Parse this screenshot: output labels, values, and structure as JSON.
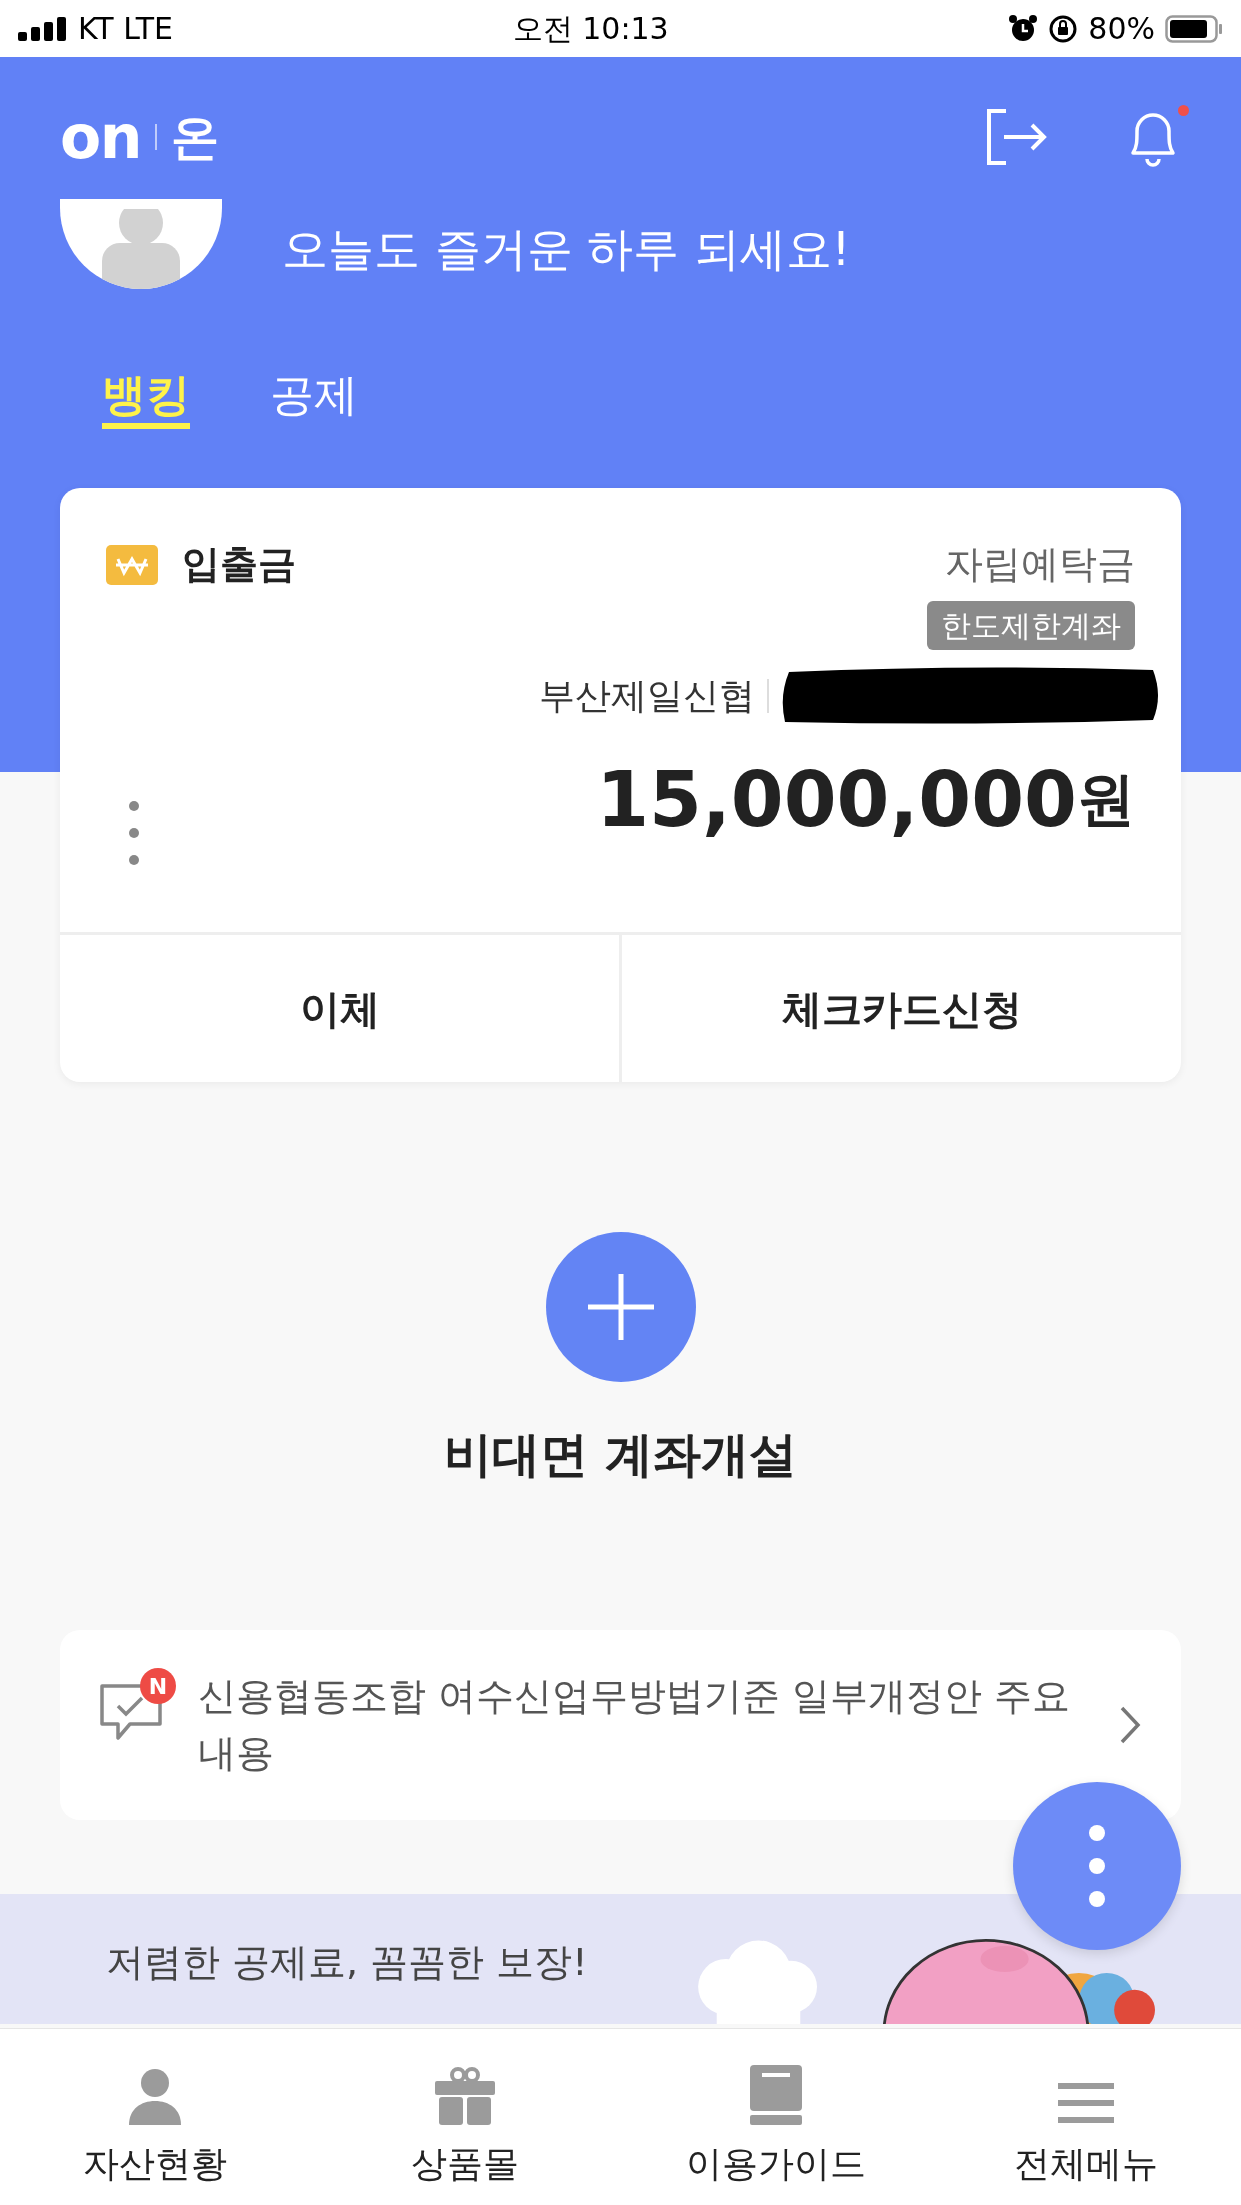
{
  "status_bar": {
    "carrier": "KT LTE",
    "time": "오전 10:13",
    "battery": "80%"
  },
  "header": {
    "logo": "on",
    "brand": "온",
    "notification_dot": true,
    "greeting": "오늘도 즐거운 하루 되세요!"
  },
  "tabs": [
    {
      "label": "뱅킹",
      "selected": true
    },
    {
      "label": "공제",
      "selected": false
    }
  ],
  "account_card": {
    "title": "입출금",
    "product": "자립예탁금",
    "badge": "한도제한계좌",
    "bank": "부산제일신협",
    "account_number_redacted": true,
    "balance": "15,000,000",
    "currency": "원",
    "actions": [
      "이체",
      "체크카드신청"
    ]
  },
  "open_account": {
    "label": "비대면 계좌개설"
  },
  "notice": {
    "is_new": true,
    "new_badge": "N",
    "text": "신용협동조합 여수신업무방법기준 일부개정안 주요내용"
  },
  "banner": {
    "text": "저렴한 공제료, 꼼꼼한 보장!"
  },
  "bottom_nav": [
    {
      "label": "자산현황"
    },
    {
      "label": "상품몰"
    },
    {
      "label": "이용가이드"
    },
    {
      "label": "전체메뉴"
    }
  ]
}
